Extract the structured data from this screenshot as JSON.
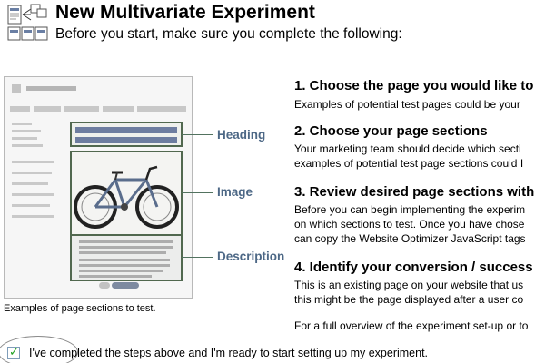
{
  "header": {
    "title": "New Multivariate Experiment",
    "subtitle": "Before you start, make sure you complete the following:",
    "icon": "experiment-pages-icon"
  },
  "illustration": {
    "labels": {
      "heading": "Heading",
      "image": "Image",
      "description": "Description"
    },
    "caption": "Examples of page sections to test."
  },
  "steps": [
    {
      "title": "1. Choose the page you would like to",
      "lines": [
        "Examples of potential test pages could be your"
      ]
    },
    {
      "title": "2. Choose your page sections",
      "lines": [
        "Your marketing team should decide which secti",
        "examples of potential test page sections could I"
      ]
    },
    {
      "title": "3. Review desired page sections with",
      "lines": [
        "Before you can begin implementing the experim",
        "on which sections to test. Once you have chose",
        "can copy the Website Optimizer JavaScript tags"
      ]
    },
    {
      "title": "4. Identify your conversion / success",
      "lines": [
        "This is an existing page on your website that us",
        "this might be the page displayed after a user co",
        "",
        "For a full overview of the experiment set-up or to"
      ]
    }
  ],
  "confirm": {
    "checked": true,
    "label": "I've completed the steps above and I'm ready to start setting up my experiment."
  },
  "colors": {
    "callout_label": "#4d6886",
    "section_border": "#51684f",
    "checkmark": "#21a121"
  }
}
